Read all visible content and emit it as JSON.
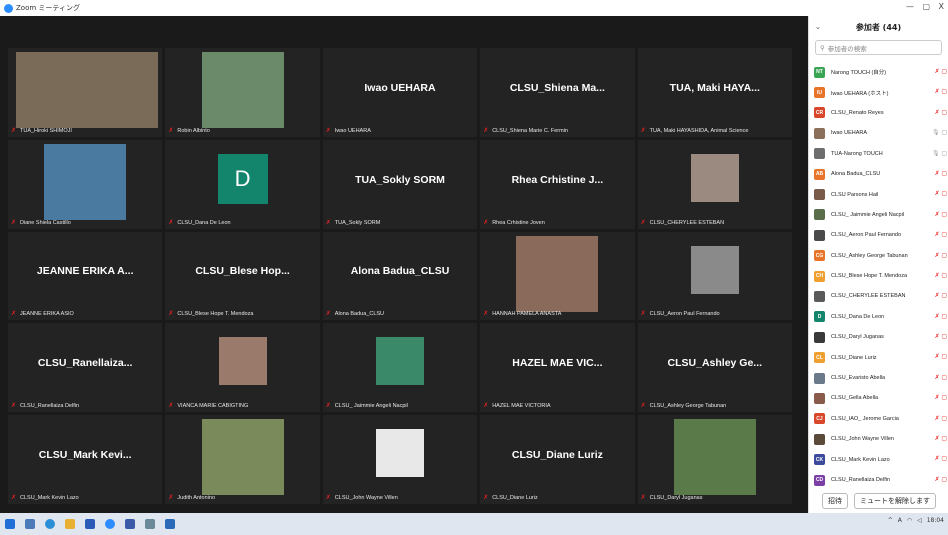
{
  "window": {
    "title": "Zoom ミーティング",
    "minimize": "—",
    "maximize": "▢",
    "close": "X"
  },
  "tiles": [
    {
      "type": "photo",
      "name": "TUA_Hiroki SHIMOJI",
      "muted": true
    },
    {
      "type": "photo",
      "name": "Robin Albinto",
      "muted": true
    },
    {
      "type": "text",
      "big": "Iwao UEHARA",
      "name": "Iwao UEHARA",
      "muted": true
    },
    {
      "type": "text",
      "big": "CLSU_Shiena  Ma...",
      "name": "CLSU_Shiena Marie C. Fermin",
      "muted": true
    },
    {
      "type": "text",
      "big": "TUA, Maki HAYA...",
      "name": "TUA, Maki HAYASHIDA, Animal Science",
      "muted": true
    },
    {
      "type": "photo",
      "name": "Diane Shiela Castillo",
      "muted": true
    },
    {
      "type": "avatar",
      "letter": "D",
      "name": "CLSU_Dana De Leon",
      "muted": true
    },
    {
      "type": "text",
      "big": "TUA_Sokly SORM",
      "name": "TUA_Sokly SORM",
      "muted": true
    },
    {
      "type": "text",
      "big": "Rhea Crhistine J...",
      "name": "Rhea Crhistine Joven",
      "muted": true
    },
    {
      "type": "photo",
      "name": "CLSU_CHERYLEE ESTEBAN",
      "muted": true
    },
    {
      "type": "text",
      "big": "JEANNE ERIKA A...",
      "name": "JEANNE ERIKA ASIO",
      "muted": true
    },
    {
      "type": "text",
      "big": "CLSU_Blese  Hop...",
      "name": "CLSU_Blese Hope T. Mendoza",
      "muted": true
    },
    {
      "type": "text",
      "big": "Alona Badua_CLSU",
      "name": "Alona Badua_CLSU",
      "muted": true
    },
    {
      "type": "photo",
      "name": "HANNAH PAMELA ANASTA",
      "muted": true
    },
    {
      "type": "photo",
      "name": "CLSU_Aeron Paul Fernando",
      "muted": true
    },
    {
      "type": "text",
      "big": "CLSU_Ranellaiza...",
      "name": "CLSU_Ranellaiza Delfin",
      "muted": true
    },
    {
      "type": "photo",
      "name": "VIANCA MARIE CABIGTING",
      "muted": true
    },
    {
      "type": "photo",
      "name": "CLSU_ Jaimmie Angeli Nacpil",
      "muted": true
    },
    {
      "type": "text",
      "big": "HAZEL MAE VIC...",
      "name": "HAZEL MAE VICTORIA",
      "muted": true
    },
    {
      "type": "text",
      "big": "CLSU_Ashley  Ge...",
      "name": "CLSU_Ashley George Tabunan",
      "muted": true
    },
    {
      "type": "text",
      "big": "CLSU_Mark  Kevi...",
      "name": "CLSU_Mark Kevin Lazo",
      "muted": true
    },
    {
      "type": "photo",
      "name": "Judith Antonino",
      "muted": true
    },
    {
      "type": "photo",
      "name": "CLSU_John Wayne Villen",
      "muted": true
    },
    {
      "type": "text",
      "big": "CLSU_Diane Luriz",
      "name": "CLSU_Diane Luriz",
      "muted": true
    },
    {
      "type": "photo",
      "name": "CLSU_Daryl Juganas",
      "muted": true
    }
  ],
  "participants_panel": {
    "title": "参加者 (44)",
    "search_placeholder": "参加者の検索",
    "invite_label": "招待",
    "unmute_label": "ミュートを解除します",
    "participants": [
      {
        "initials": "NT",
        "color": "#3aa655",
        "name": "Narong TOUCH (自分)"
      },
      {
        "initials": "IU",
        "color": "#e8742a",
        "name": "Iwao UEHARA (ホスト)"
      },
      {
        "initials": "CR",
        "color": "#d9472b",
        "name": "CLSU_Renato Reyes"
      },
      {
        "initials": "",
        "color": "#8a6f5a",
        "name": "Iwao UEHARA"
      },
      {
        "initials": "",
        "color": "#6d6d6d",
        "name": "TUA-Narong TOUCH"
      },
      {
        "initials": "AB",
        "color": "#e8742a",
        "name": "Alona Badua_CLSU"
      },
      {
        "initials": "",
        "color": "#7a5a48",
        "name": "CLSU Parsons Hail"
      },
      {
        "initials": "",
        "color": "#5a6e4a",
        "name": "CLSU_ Jaimmie Angeli Nacpil"
      },
      {
        "initials": "",
        "color": "#4a4a4a",
        "name": "CLSU_Aeron Paul Fernando"
      },
      {
        "initials": "CG",
        "color": "#e8742a",
        "name": "CLSU_Ashley George Tabunan"
      },
      {
        "initials": "CH",
        "color": "#f0a030",
        "name": "CLSU_Blese Hope T. Mendoza"
      },
      {
        "initials": "",
        "color": "#5a5a5a",
        "name": "CLSU_CHERYLEE ESTEBAN"
      },
      {
        "initials": "D",
        "color": "#14856d",
        "name": "CLSU_Dana De Leon"
      },
      {
        "initials": "",
        "color": "#3a3a3a",
        "name": "CLSU_Daryl Juganas"
      },
      {
        "initials": "CL",
        "color": "#f0a030",
        "name": "CLSU_Diane Luriz"
      },
      {
        "initials": "",
        "color": "#6a7a8a",
        "name": "CLSU_Evaristo Abella"
      },
      {
        "initials": "",
        "color": "#8a5a4a",
        "name": "CLSU_Gella Abella"
      },
      {
        "initials": "CJ",
        "color": "#d9472b",
        "name": "CLSU_IAO_ Jerome Garcia"
      },
      {
        "initials": "",
        "color": "#5a4a3a",
        "name": "CLSU_John Wayne Villen"
      },
      {
        "initials": "CK",
        "color": "#3b4a9a",
        "name": "CLSU_Mark Kevin Lazo"
      },
      {
        "initials": "CD",
        "color": "#7b3fa6",
        "name": "CLSU_Ranellaiza Delfin"
      }
    ]
  },
  "taskbar": {
    "ime": "A",
    "clock": "18:04"
  }
}
